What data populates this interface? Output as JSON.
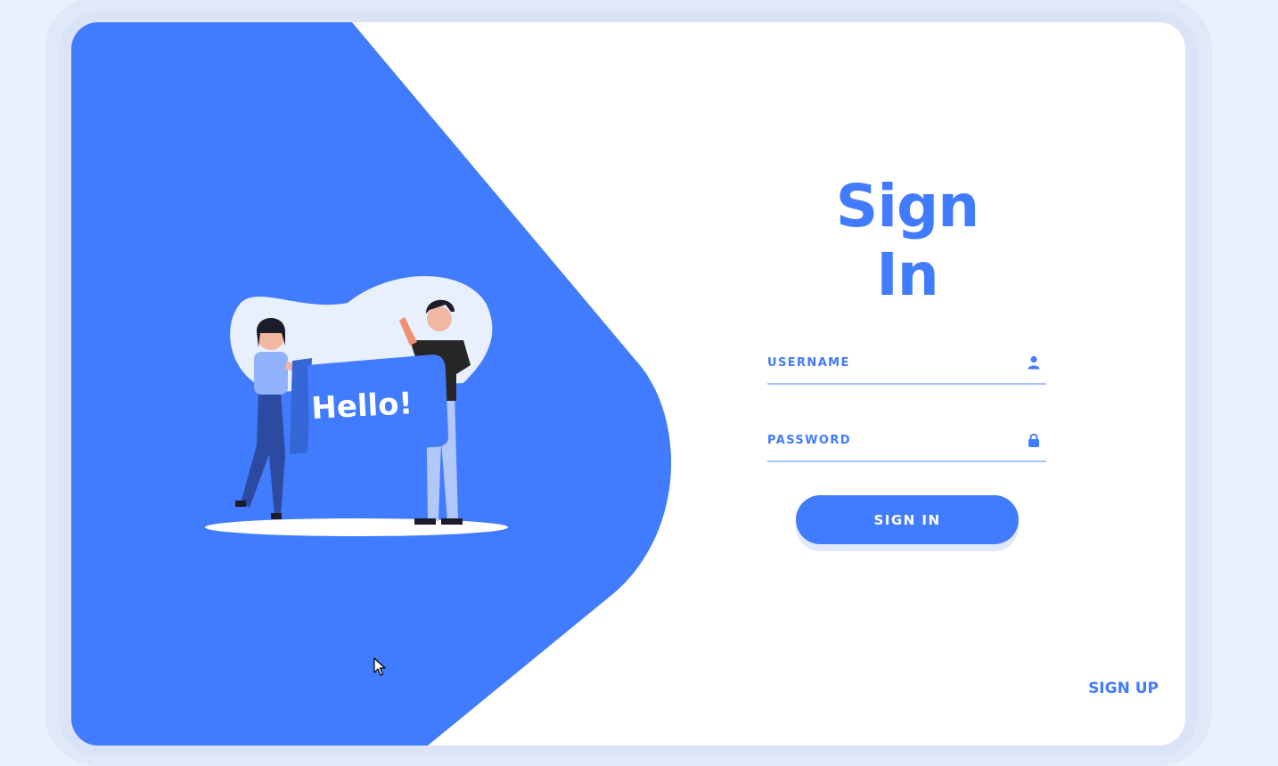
{
  "colors": {
    "accent": "#417bfe",
    "underline": "#a9c2fb",
    "background": "#eaf0fd",
    "card": "#ffffff"
  },
  "illustration": {
    "banner_text": "Hello!"
  },
  "form": {
    "title": "Sign In",
    "username": {
      "placeholder": "USERNAME",
      "value": "",
      "icon": "user-icon"
    },
    "password": {
      "placeholder": "PASSWORD",
      "value": "",
      "icon": "lock-icon"
    },
    "submit_label": "SIGN IN"
  },
  "footer": {
    "signup_label": "SIGN UP"
  }
}
